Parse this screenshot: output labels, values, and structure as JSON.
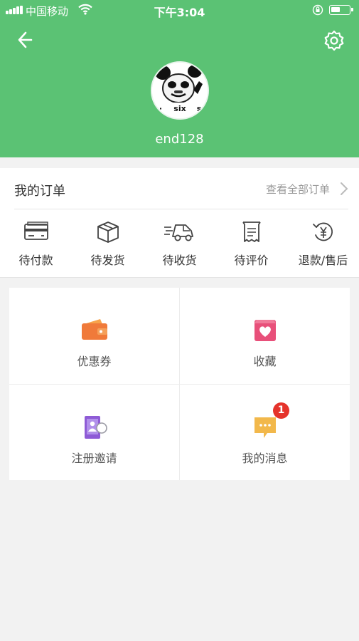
{
  "status_bar": {
    "carrier": "中国移动",
    "time": "下午3:04",
    "icons": [
      "signal-icon",
      "wifi-icon",
      "orientation-lock-icon",
      "battery-icon"
    ]
  },
  "header": {
    "background_color": "#5bc274",
    "back_icon": "back-arrow-icon",
    "settings_icon": "settings-gear-icon"
  },
  "profile": {
    "avatar_caption": "six",
    "username": "end128"
  },
  "orders": {
    "title": "我的订单",
    "view_all_label": "查看全部订单",
    "items": [
      {
        "label": "待付款",
        "icon": "card-icon"
      },
      {
        "label": "待发货",
        "icon": "package-box-icon"
      },
      {
        "label": "待收货",
        "icon": "delivery-truck-icon"
      },
      {
        "label": "待评价",
        "icon": "receipt-icon"
      },
      {
        "label": "退款/售后",
        "icon": "refund-yen-icon"
      }
    ]
  },
  "services": [
    {
      "label": "优惠券",
      "icon": "wallet-icon",
      "color": "#f07a3a"
    },
    {
      "label": "收藏",
      "icon": "heart-icon",
      "color": "#e8507a"
    },
    {
      "label": "注册邀请",
      "icon": "invite-user-icon",
      "color": "#8e5bd6"
    },
    {
      "label": "我的消息",
      "icon": "message-icon",
      "color": "#f2b84b",
      "badge": "1"
    }
  ],
  "colors": {
    "badge": "#e5332b",
    "page_background": "#f2f2f2"
  }
}
